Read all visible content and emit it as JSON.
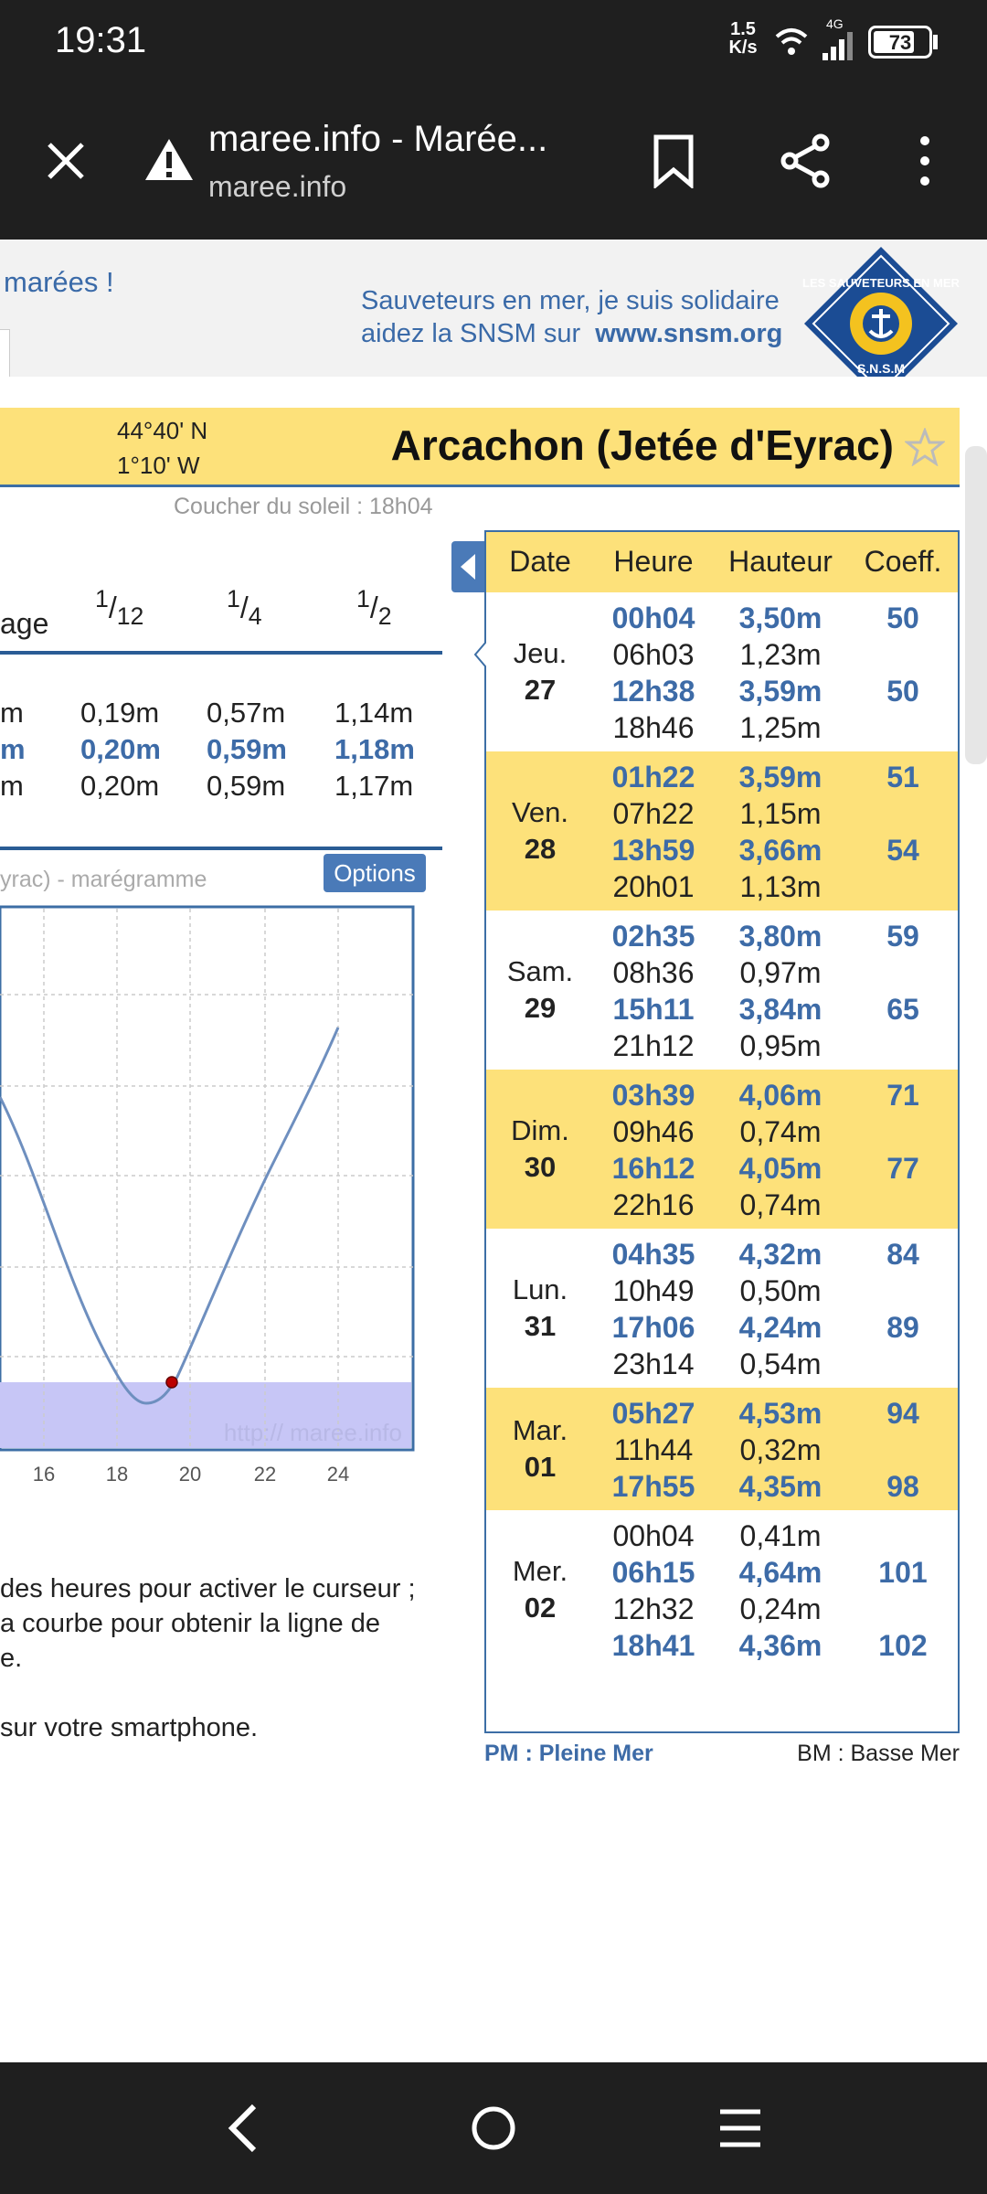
{
  "status": {
    "time": "19:31",
    "speed_value": "1.5",
    "speed_unit": "K/s",
    "network": "4G",
    "battery": "73"
  },
  "browser": {
    "title": "maree.info - Marée...",
    "url": "maree.info"
  },
  "banner": {
    "left_text": "marées !",
    "snsm_line1": "Sauveteurs en mer, je suis solidaire",
    "snsm_line2_prefix": "aidez la SNSM sur",
    "snsm_link": "www.snsm.org",
    "logo_top": "LES SAUVETEURS EN MER",
    "logo_bottom": "S.N.S.M"
  },
  "location": {
    "lat": "44°40' N",
    "lon": "1°10' W",
    "name": "Arcachon (Jetée d'Eyrac)",
    "sunset": "Coucher du soleil : 18h04"
  },
  "fractions": {
    "col0": "age",
    "col1_num": "1",
    "col1_den": "12",
    "col2_num": "1",
    "col2_den": "4",
    "col3_num": "1",
    "col3_den": "2"
  },
  "marnage_rows": [
    {
      "a": "m",
      "b": "0,19m",
      "c": "0,57m",
      "d": "1,14m",
      "hl": false
    },
    {
      "a": "m",
      "b": "0,20m",
      "c": "0,59m",
      "d": "1,18m",
      "hl": true
    },
    {
      "a": "m",
      "b": "0,20m",
      "c": "0,59m",
      "d": "1,17m",
      "hl": false
    }
  ],
  "chart": {
    "title": "yrac) - marégramme",
    "options": "Options",
    "watermark": "http:// maree.info",
    "xticks": [
      "16",
      "18",
      "20",
      "22",
      "24"
    ]
  },
  "instructions": {
    "l1": "des heures pour activer le curseur ;",
    "l2": "a courbe pour obtenir la ligne de",
    "l3": "e.",
    "l4": "sur votre smartphone."
  },
  "table": {
    "headers": {
      "date": "Date",
      "heure": "Heure",
      "hauteur": "Hauteur",
      "coeff": "Coeff."
    },
    "days": [
      {
        "name": "Jeu.",
        "num": "27",
        "bg": "#ffffff",
        "rows": [
          [
            "00h04",
            "3,50m",
            "50",
            true
          ],
          [
            "06h03",
            "1,23m",
            "",
            false
          ],
          [
            "12h38",
            "3,59m",
            "50",
            true
          ],
          [
            "18h46",
            "1,25m",
            "",
            false
          ]
        ]
      },
      {
        "name": "Ven.",
        "num": "28",
        "bg": "#fde17a",
        "rows": [
          [
            "01h22",
            "3,59m",
            "51",
            true
          ],
          [
            "07h22",
            "1,15m",
            "",
            false
          ],
          [
            "13h59",
            "3,66m",
            "54",
            true
          ],
          [
            "20h01",
            "1,13m",
            "",
            false
          ]
        ]
      },
      {
        "name": "Sam.",
        "num": "29",
        "bg": "#ffffff",
        "rows": [
          [
            "02h35",
            "3,80m",
            "59",
            true
          ],
          [
            "08h36",
            "0,97m",
            "",
            false
          ],
          [
            "15h11",
            "3,84m",
            "65",
            true
          ],
          [
            "21h12",
            "0,95m",
            "",
            false
          ]
        ]
      },
      {
        "name": "Dim.",
        "num": "30",
        "bg": "#fde17a",
        "rows": [
          [
            "03h39",
            "4,06m",
            "71",
            true
          ],
          [
            "09h46",
            "0,74m",
            "",
            false
          ],
          [
            "16h12",
            "4,05m",
            "77",
            true
          ],
          [
            "22h16",
            "0,74m",
            "",
            false
          ]
        ]
      },
      {
        "name": "Lun.",
        "num": "31",
        "bg": "#ffffff",
        "rows": [
          [
            "04h35",
            "4,32m",
            "84",
            true
          ],
          [
            "10h49",
            "0,50m",
            "",
            false
          ],
          [
            "17h06",
            "4,24m",
            "89",
            true
          ],
          [
            "23h14",
            "0,54m",
            "",
            false
          ]
        ]
      },
      {
        "name": "Mar.",
        "num": "01",
        "bg": "#fde17a",
        "rows": [
          [
            "05h27",
            "4,53m",
            "94",
            true
          ],
          [
            "11h44",
            "0,32m",
            "",
            false
          ],
          [
            "17h55",
            "4,35m",
            "98",
            true
          ]
        ]
      },
      {
        "name": "Mer.",
        "num": "02",
        "bg": "#ffffff",
        "rows": [
          [
            "00h04",
            "0,41m",
            "",
            false
          ],
          [
            "06h15",
            "4,64m",
            "101",
            true
          ],
          [
            "12h32",
            "0,24m",
            "",
            false
          ],
          [
            "18h41",
            "4,36m",
            "102",
            true
          ]
        ]
      }
    ],
    "legend_pm": "PM : Pleine Mer",
    "legend_bm": "BM : Basse Mer"
  },
  "colors": {
    "yellow": "#fde17a",
    "blue": "#3d6ba7",
    "chart_line": "#6e8fbf",
    "low_band": "#c7c6f6"
  }
}
